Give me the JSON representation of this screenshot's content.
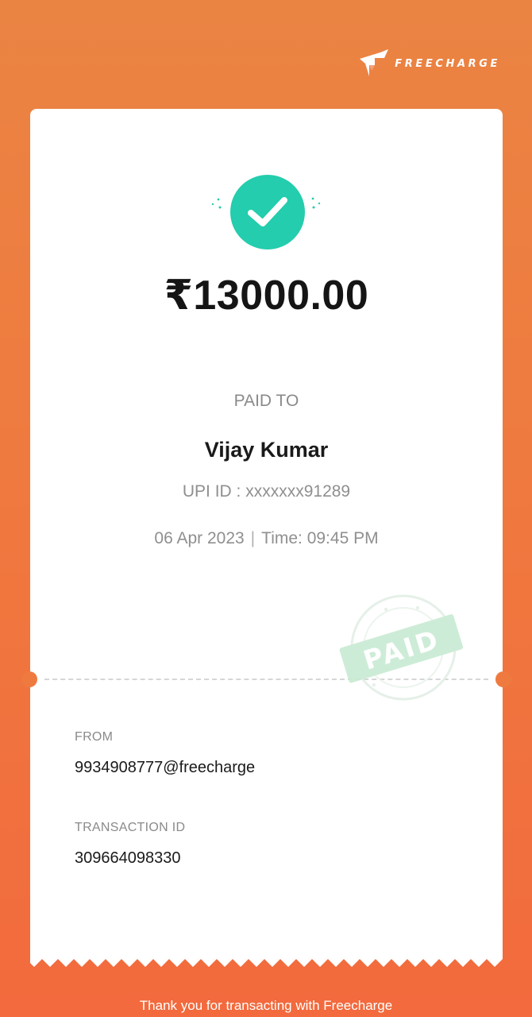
{
  "brand": {
    "name": "FREECHARGE",
    "logo_icon": "freecharge-logo-icon"
  },
  "receipt": {
    "status_icon": "check-icon",
    "amount": "₹13000.00",
    "paid_to_label": "PAID TO",
    "payee_name": "Vijay Kumar",
    "upi_id": "UPI ID : xxxxxxx91289",
    "date": "06 Apr 2023",
    "date_time_separator": "|",
    "time": "Time: 09:45 PM",
    "stamp_text": "PAID",
    "from": {
      "label": "FROM",
      "value": "9934908777@freecharge"
    },
    "transaction": {
      "label": "TRANSACTION ID",
      "value": "309664098330"
    }
  },
  "footer": {
    "thanks": "Thank you for transacting with Freecharge"
  },
  "colors": {
    "background_top": "#ea8443",
    "background_bottom": "#f26a3d",
    "success": "#23cdad",
    "stamp": "#bfe6cc",
    "card": "#ffffff"
  }
}
